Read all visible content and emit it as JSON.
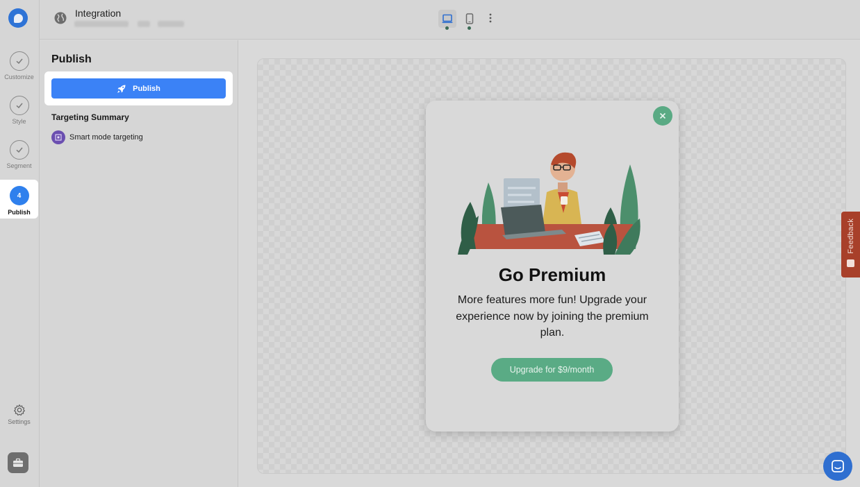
{
  "header": {
    "title": "Integration"
  },
  "steps": [
    {
      "label": "Customize",
      "state": "done"
    },
    {
      "label": "Style",
      "state": "done"
    },
    {
      "label": "Segment",
      "state": "done"
    },
    {
      "label": "Publish",
      "number": "4",
      "state": "active"
    }
  ],
  "rail": {
    "settings_label": "Settings"
  },
  "panel": {
    "title": "Publish",
    "publish_button": "Publish",
    "targeting_title": "Targeting Summary",
    "targeting_item": "Smart mode targeting"
  },
  "popup": {
    "title": "Go Premium",
    "body": "More features more fun! Upgrade your experience now by joining the premium plan.",
    "cta": "Upgrade for $9/month"
  },
  "feedback": {
    "label": "Feedback"
  },
  "colors": {
    "accent": "#3b82f6",
    "popup_green": "#5aab85",
    "feedback_tab": "#a8402a"
  }
}
